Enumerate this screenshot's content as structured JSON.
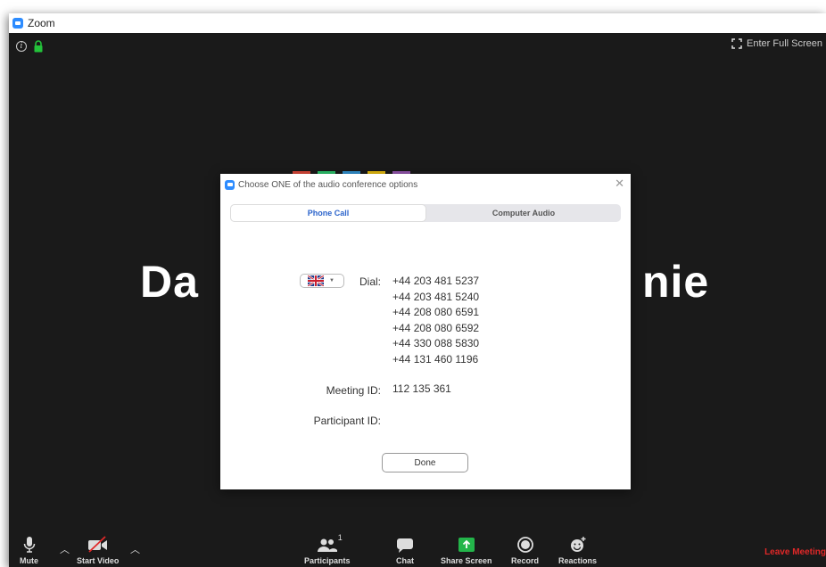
{
  "window": {
    "title": "Zoom"
  },
  "top_bar": {
    "fullscreen_label": "Enter Full Screen"
  },
  "participant_name": {
    "left_part": "Da",
    "right_part": "nie"
  },
  "dialog": {
    "title": "Choose ONE of the audio conference options",
    "tabs": [
      {
        "label": "Phone Call",
        "active": true
      },
      {
        "label": "Computer Audio",
        "active": false
      }
    ],
    "country_flag": "uk-flag-icon",
    "dial_label": "Dial:",
    "numbers": [
      "+44 203 481 5237",
      "+44 203 481 5240",
      "+44 208 080 6591",
      "+44 208 080 6592",
      "+44 330 088 5830",
      "+44 131 460 1196"
    ],
    "meeting_id_label": "Meeting ID:",
    "meeting_id": "112 135 361",
    "participant_id_label": "Participant ID:",
    "done_label": "Done"
  },
  "toolbar": {
    "mute_label": "Mute",
    "start_video_label": "Start Video",
    "participants_label": "Participants",
    "participants_count": "1",
    "chat_label": "Chat",
    "share_screen_label": "Share Screen",
    "record_label": "Record",
    "reactions_label": "Reactions",
    "leave_label": "Leave Meeting"
  },
  "colors": {
    "zoom_blue": "#2d8cff",
    "share_green": "#23b54a",
    "leave_red": "#e02828",
    "lock_green": "#23c23a"
  }
}
